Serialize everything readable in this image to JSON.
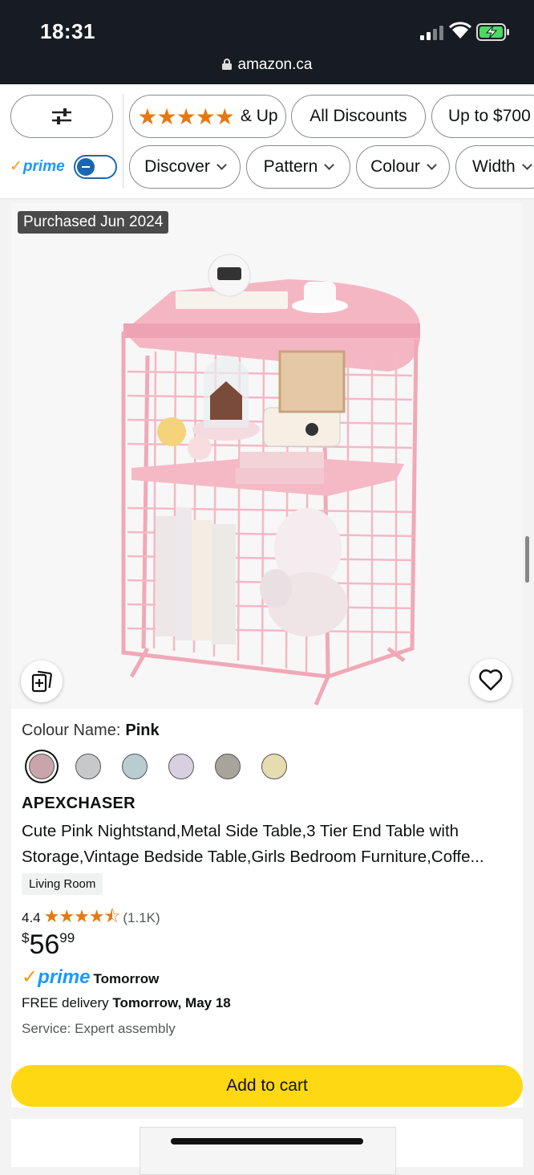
{
  "status": {
    "time": "18:31",
    "url": "amazon.ca"
  },
  "filters": {
    "sliders_icon": "sliders-icon",
    "rating_stars": "★★★★★",
    "rating_label": "& Up",
    "discounts": "All Discounts",
    "price": "Up to $700",
    "prime_label": "prime",
    "discover": "Discover",
    "pattern": "Pattern",
    "colour": "Colour",
    "width": "Width"
  },
  "product": {
    "badge": "Purchased Jun 2024",
    "colour_label": "Colour Name:",
    "colour_value": "Pink",
    "swatches": [
      "#c9a5ab",
      "#c7c8ca",
      "#b9cdd0",
      "#d8cfe0",
      "#a8a49c",
      "#e5dcb0"
    ],
    "brand": "APEXCHASER",
    "title": "Cute Pink Nightstand,Metal Side Table,3 Tier End Table with Storage,Vintage Bedside Table,Girls Bedroom Furniture,Coffe...",
    "tag": "Living Room",
    "rating": "4.4",
    "rating_stars": "★★★★⯪",
    "review_count": "(1.1K)",
    "price_currency": "$",
    "price_whole": "56",
    "price_fraction": "99",
    "prime_word": "prime",
    "prime_tomorrow": "Tomorrow",
    "delivery_prefix": "FREE delivery ",
    "delivery_date": "Tomorrow, May 18",
    "service": "Service: Expert assembly",
    "add_to_cart": "Add to cart"
  },
  "colors": {
    "accent_pink": "#f2b8c6",
    "cart_yellow": "#ffd814",
    "prime_blue": "#1a98ff",
    "star_orange": "#e47911"
  }
}
